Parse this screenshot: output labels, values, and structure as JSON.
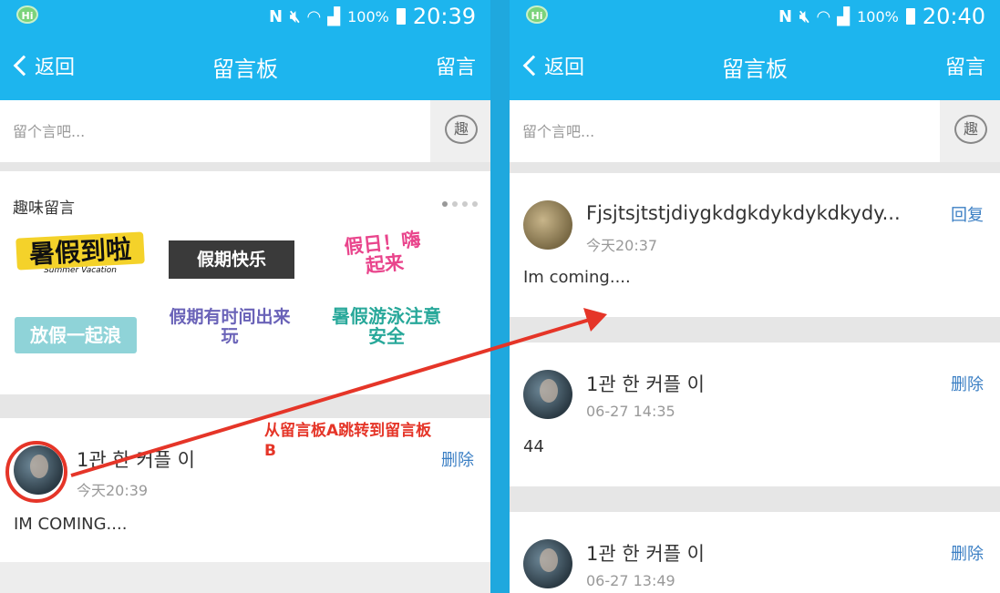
{
  "left": {
    "statusbar": {
      "hi": "Hi",
      "n_icon": "N",
      "battery": "100%",
      "time": "20:39"
    },
    "navbar": {
      "back": "返回",
      "title": "留言板",
      "action": "留言"
    },
    "input": {
      "placeholder": "留个言吧...",
      "fun_button": "趣"
    },
    "fun": {
      "title": "趣味留言",
      "stickers": [
        "暑假到啦",
        "假期快乐",
        "假日！嗨起来",
        "放假一起浪",
        "假期有时间出来玩",
        "暑假游泳注意安全"
      ],
      "sticker_sub": "Summer Vacation"
    },
    "message": {
      "name": "1관 한 커플 이",
      "time": "今天20:39",
      "action": "删除",
      "content": "IM COMING...."
    }
  },
  "annotation": {
    "line1": "从留言板A跳转到留言板",
    "line2": "B"
  },
  "right": {
    "statusbar": {
      "hi": "Hi",
      "n_icon": "N",
      "battery": "100%",
      "time": "20:40"
    },
    "navbar": {
      "back": "返回",
      "title": "留言板",
      "action": "留言"
    },
    "input": {
      "placeholder": "留个言吧...",
      "fun_button": "趣"
    },
    "messages": [
      {
        "name": "Fjsjtsjtstjdiygkdgkdykdykdkydy...",
        "time": "今天20:37",
        "action": "回复",
        "content": "Im coming...."
      },
      {
        "name": "1관 한 커플 이",
        "time": "06-27 14:35",
        "action": "删除",
        "content": "44"
      },
      {
        "name": "1관 한 커플 이",
        "time": "06-27 13:49",
        "action": "删除",
        "content": ""
      }
    ]
  },
  "colors": {
    "brand": "#1db5ee",
    "link": "#3b7fc4",
    "annotation": "#e53528"
  }
}
